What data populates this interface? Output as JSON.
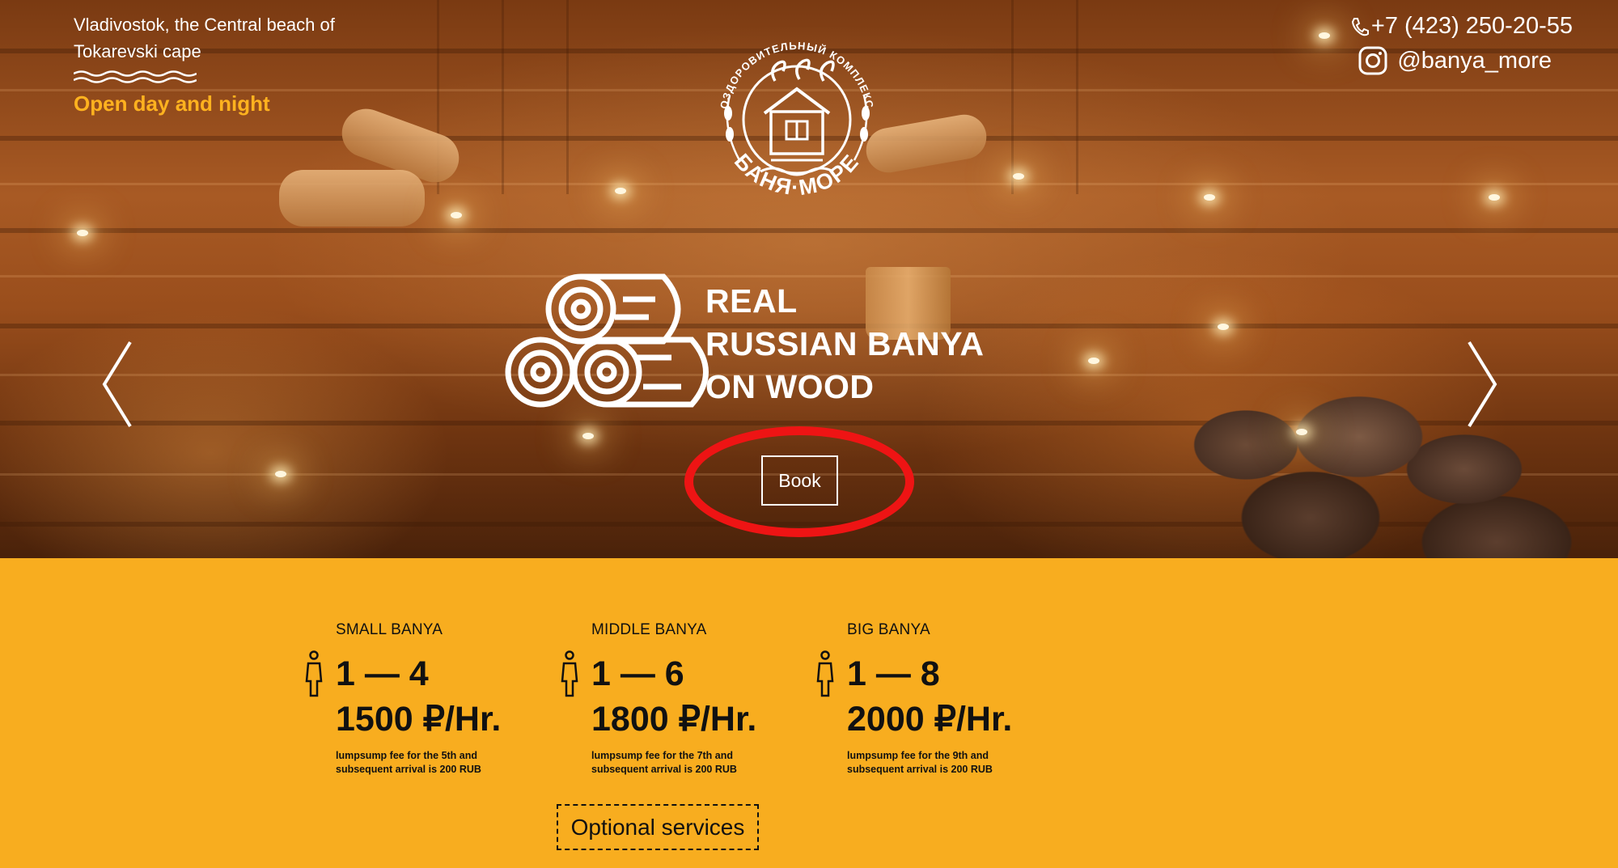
{
  "header": {
    "address": "Vladivostok, the Central beach of Tokarevski cape",
    "hours": "Open day and night",
    "phone": "+7 (423) 250-20-55",
    "instagram": "@banya_more"
  },
  "logo": {
    "arc_text": "ОЗДОРОВИТЕЛЬНЫЙ КОМПЛЕКС",
    "brand_text": "БАНЯ·МОРЕ"
  },
  "hero": {
    "tagline_line1": "REAL",
    "tagline_line2": "RUSSIAN BANYA",
    "tagline_line3": "ON WOOD",
    "book_label": "Book",
    "prev_arrow": "chevron-left-icon",
    "next_arrow": "chevron-right-icon"
  },
  "pricing": {
    "cards": [
      {
        "title": "SMALL BANYA",
        "capacity": "1 — 4",
        "price": "1500 ₽/Hr.",
        "note": "lumpsump fee for the 5th and subsequent arrival is 200 RUB"
      },
      {
        "title": "MIDDLE BANYA",
        "capacity": "1 — 6",
        "price": "1800 ₽/Hr.",
        "note": "lumpsump fee for the 7th and subsequent arrival is 200 RUB"
      },
      {
        "title": "BIG BANYA",
        "capacity": "1 — 8",
        "price": "2000 ₽/Hr.",
        "note": "lumpsump fee for the 9th and subsequent arrival is 200 RUB"
      }
    ],
    "optional_label": "Optional services"
  },
  "colors": {
    "accent": "#f8ad1f",
    "hours_text": "#ffb21f",
    "highlight": "#ee1414"
  }
}
